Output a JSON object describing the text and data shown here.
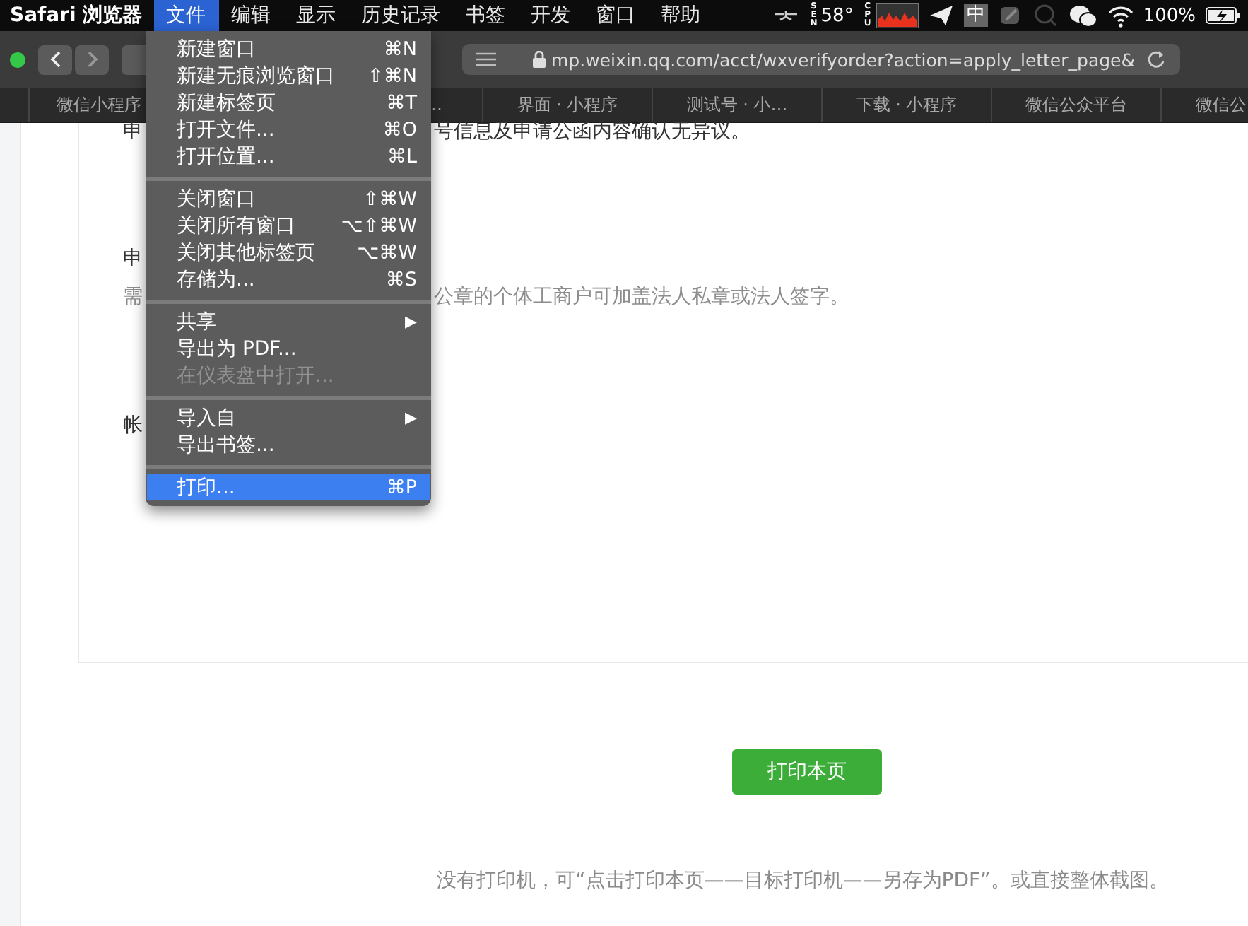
{
  "menu_bar": {
    "app": "Safari 浏览器",
    "menus": [
      {
        "label": "文件",
        "selected": true
      },
      {
        "label": "编辑",
        "selected": false
      },
      {
        "label": "显示",
        "selected": false
      },
      {
        "label": "历史记录",
        "selected": false
      },
      {
        "label": "书签",
        "selected": false
      },
      {
        "label": "开发",
        "selected": false
      },
      {
        "label": "窗口",
        "selected": false
      },
      {
        "label": "帮助",
        "selected": false
      }
    ],
    "status": {
      "sensor": "SEN",
      "temperature": "58°",
      "cpu": "CPU",
      "input_method": "中",
      "battery": "100%"
    }
  },
  "toolbar": {
    "url": "mp.weixin.qq.com/acct/wxverifyorder?action=apply_letter_page&"
  },
  "tabs": [
    {
      "label": "微信小程序"
    },
    {
      "label": "…"
    },
    {
      "label": "界面 · 小程序"
    },
    {
      "label": "测试号 · 小…"
    },
    {
      "label": "下载 · 小程序"
    },
    {
      "label": "微信公众平台"
    },
    {
      "label": "微信公"
    }
  ],
  "page": {
    "lines": [
      {
        "head": "申",
        "tail": "号信息及申请公函内容确认无异议。",
        "muted": false
      },
      {
        "head": "申",
        "muted": false
      },
      {
        "head": "需",
        "tail": "公章的个体工商户可加盖法人私章或法人签字。",
        "muted": true
      },
      {
        "head": "帐",
        "muted": false
      }
    ],
    "print_button": "打印本页",
    "note": "没有打印机，可“点击打印本页——目标打印机——另存为PDF”。或直接整体截图。"
  },
  "file_menu": [
    {
      "kind": "item",
      "label": "新建窗口",
      "shortcut": "⌘N",
      "disabled": false,
      "selected": false
    },
    {
      "kind": "item",
      "label": "新建无痕浏览窗口",
      "shortcut": "⇧⌘N",
      "disabled": false,
      "selected": false
    },
    {
      "kind": "item",
      "label": "新建标签页",
      "shortcut": "⌘T",
      "disabled": false,
      "selected": false
    },
    {
      "kind": "item",
      "label": "打开文件...",
      "shortcut": "⌘O",
      "disabled": false,
      "selected": false
    },
    {
      "kind": "item",
      "label": "打开位置...",
      "shortcut": "⌘L",
      "disabled": false,
      "selected": false
    },
    {
      "kind": "separator"
    },
    {
      "kind": "item",
      "label": "关闭窗口",
      "shortcut": "⇧⌘W",
      "disabled": false,
      "selected": false
    },
    {
      "kind": "item",
      "label": "关闭所有窗口",
      "shortcut": "⌥⇧⌘W",
      "disabled": false,
      "selected": false
    },
    {
      "kind": "item",
      "label": "关闭其他标签页",
      "shortcut": "⌥⌘W",
      "disabled": false,
      "selected": false
    },
    {
      "kind": "item",
      "label": "存储为...",
      "shortcut": "⌘S",
      "disabled": false,
      "selected": false
    },
    {
      "kind": "separator"
    },
    {
      "kind": "submenu",
      "label": "共享",
      "shortcut": "▶",
      "disabled": false,
      "selected": false
    },
    {
      "kind": "item",
      "label": "导出为 PDF...",
      "disabled": false,
      "selected": false
    },
    {
      "kind": "item",
      "label": "在仪表盘中打开...",
      "disabled": true,
      "selected": false
    },
    {
      "kind": "separator"
    },
    {
      "kind": "submenu",
      "label": "导入自",
      "shortcut": "▶",
      "disabled": false,
      "selected": false
    },
    {
      "kind": "item",
      "label": "导出书签...",
      "disabled": false,
      "selected": false
    },
    {
      "kind": "separator"
    },
    {
      "kind": "item",
      "label": "打印...",
      "shortcut": "⌘P",
      "disabled": false,
      "selected": true
    }
  ]
}
